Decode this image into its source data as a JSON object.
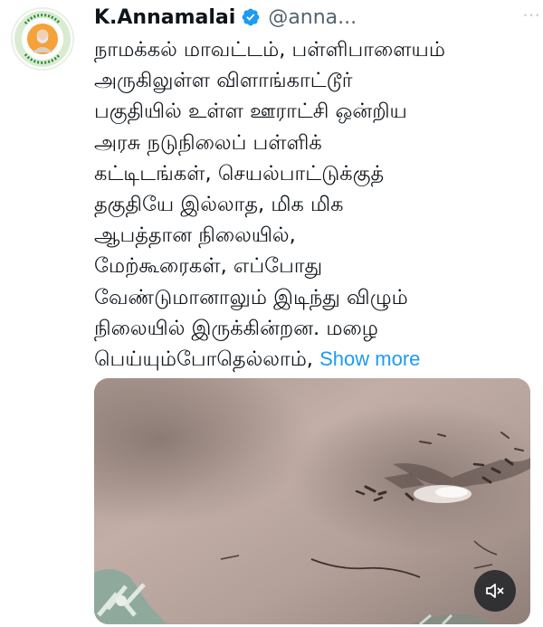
{
  "author": {
    "name": "K.Annamalai",
    "handle": "@anna...",
    "verified": true
  },
  "tweet": {
    "lines": [
      "நாமக்கல் மாவட்டம், பள்ளிபாளையம்",
      "அருகிலுள்ள விளாங்காட்டூர்",
      "பகுதியில் உள்ள ஊராட்சி ஒன்றிய",
      "அரசு நடுநிலைப் பள்ளிக்",
      "கட்டிடங்கள், செயல்பாட்டுக்குத்",
      "தகுதியே இல்லாத, மிக மிக",
      "ஆபத்தான நிலையில்,",
      "மேற்கூரைகள், எப்போது",
      "வேண்டுமானாலும் இடிந்து விழும்",
      "நிலையில் இருக்கின்றன. மழை",
      "பெய்யும்போதெல்லாம்,"
    ],
    "show_more": "Show more"
  },
  "media": {
    "type": "video",
    "muted": true
  },
  "icons": {
    "verified": "verified-badge-icon",
    "mute": "speaker-muted-icon",
    "more": "more-options-icon"
  },
  "colors": {
    "link": "#1d9bf0",
    "verified": "#1d9bf0",
    "text": "#0f1419",
    "secondary": "#536471"
  }
}
